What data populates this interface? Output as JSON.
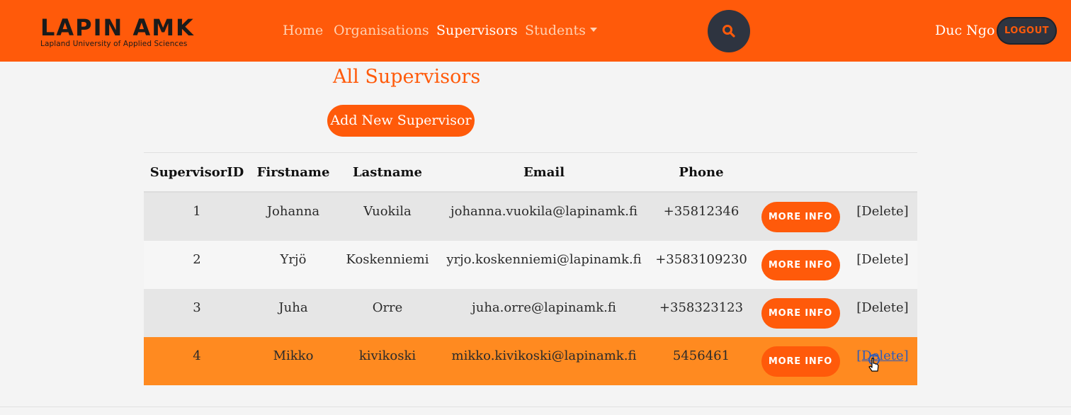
{
  "brand": {
    "name": "LAPIN AMK",
    "subtitle": "Lapland University of Applied Sciences"
  },
  "nav": {
    "home": "Home",
    "organisations": "Organisations",
    "supervisors": "Supervisors",
    "students": "Students"
  },
  "user": {
    "name": "Duc Ngo",
    "logout_label": "LOGOUT"
  },
  "page": {
    "title": "All Supervisors",
    "add_button": "Add New Supervisor"
  },
  "table": {
    "headers": [
      "SupervisorID",
      "Firstname",
      "Lastname",
      "Email",
      "Phone"
    ],
    "more_info_label": "MORE INFO",
    "delete_label": "[Delete]",
    "rows": [
      {
        "id": "1",
        "firstname": "Johanna",
        "lastname": "Vuokila",
        "email": "johanna.vuokila@lapinamk.fi",
        "phone": "+35812346"
      },
      {
        "id": "2",
        "firstname": "Yrjö",
        "lastname": "Koskenniemi",
        "email": "yrjo.koskenniemi@lapinamk.fi",
        "phone": "+3583109230"
      },
      {
        "id": "3",
        "firstname": "Juha",
        "lastname": "Orre",
        "email": "juha.orre@lapinamk.fi",
        "phone": "+358323123"
      },
      {
        "id": "4",
        "firstname": "Mikko",
        "lastname": "kivikoski",
        "email": "mikko.kivikoski@lapinamk.fi",
        "phone": "5456461"
      }
    ]
  },
  "colors": {
    "primary": "#ff5a0a",
    "dark": "#2e3440",
    "row_hover": "#ff8a20",
    "link": "#2e5bb8"
  }
}
